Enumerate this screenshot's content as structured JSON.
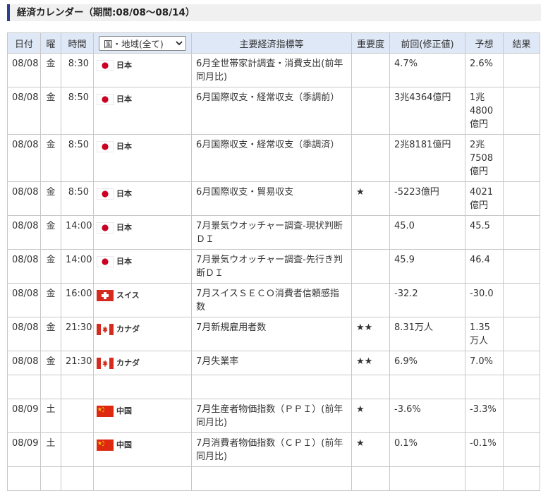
{
  "page": {
    "title": "経済カレンダー（期間:08/08〜08/14）"
  },
  "colors": {
    "accent": "#2d3f8f",
    "header_bg": "#dfe8f7"
  },
  "columns": {
    "date": "日付",
    "weekday": "曜",
    "time": "時間",
    "region_filter": "国・地域(全て)",
    "indicator": "主要経済指標等",
    "importance": "重要度",
    "previous": "前回(修正値)",
    "forecast": "予想",
    "result": "結果"
  },
  "rows": [
    {
      "date": "08/08",
      "weekday": "金",
      "time": "8:30",
      "flag": "japan-flag-icon",
      "country": "日本",
      "indicator": "6月全世帯家計調査・消費支出(前年同月比)",
      "importance": "",
      "previous": "4.7%",
      "forecast": "2.6%",
      "result": ""
    },
    {
      "date": "08/08",
      "weekday": "金",
      "time": "8:50",
      "flag": "japan-flag-icon",
      "country": "日本",
      "indicator": "6月国際収支・経常収支（季調前）",
      "importance": "",
      "previous": "3兆4364億円",
      "forecast": "1兆4800億円",
      "result": ""
    },
    {
      "date": "08/08",
      "weekday": "金",
      "time": "8:50",
      "flag": "japan-flag-icon",
      "country": "日本",
      "indicator": "6月国際収支・経常収支（季調済）",
      "importance": "",
      "previous": "2兆8181億円",
      "forecast": "2兆7508億円",
      "result": ""
    },
    {
      "date": "08/08",
      "weekday": "金",
      "time": "8:50",
      "flag": "japan-flag-icon",
      "country": "日本",
      "indicator": "6月国際収支・貿易収支",
      "importance": "★",
      "previous": "-5223億円",
      "forecast": "4021億円",
      "result": ""
    },
    {
      "date": "08/08",
      "weekday": "金",
      "time": "14:00",
      "flag": "japan-flag-icon",
      "country": "日本",
      "indicator": "7月景気ウオッチャー調査-現状判断ＤＩ",
      "importance": "",
      "previous": "45.0",
      "forecast": "45.5",
      "result": ""
    },
    {
      "date": "08/08",
      "weekday": "金",
      "time": "14:00",
      "flag": "japan-flag-icon",
      "country": "日本",
      "indicator": "7月景気ウオッチャー調査-先行き判断ＤＩ",
      "importance": "",
      "previous": "45.9",
      "forecast": "46.4",
      "result": ""
    },
    {
      "date": "08/08",
      "weekday": "金",
      "time": "16:00",
      "flag": "swiss-flag-icon",
      "country": "スイス",
      "indicator": "7月スイスＳＥＣＯ消費者信頼感指数",
      "importance": "",
      "previous": "-32.2",
      "forecast": "-30.0",
      "result": ""
    },
    {
      "date": "08/08",
      "weekday": "金",
      "time": "21:30",
      "flag": "canada-flag-icon",
      "country": "カナダ",
      "indicator": "7月新規雇用者数",
      "importance": "★★",
      "previous": "8.31万人",
      "forecast": "1.35万人",
      "result": ""
    },
    {
      "date": "08/08",
      "weekday": "金",
      "time": "21:30",
      "flag": "canada-flag-icon",
      "country": "カナダ",
      "indicator": "7月失業率",
      "importance": "★★",
      "previous": "6.9%",
      "forecast": "7.0%",
      "result": ""
    },
    {
      "blank": true
    },
    {
      "date": "08/09",
      "weekday": "土",
      "time": "",
      "flag": "china-flag-icon",
      "country": "中国",
      "indicator": "7月生産者物価指数（ＰＰＩ）(前年同月比)",
      "importance": "★",
      "previous": "-3.6%",
      "forecast": "-3.3%",
      "result": ""
    },
    {
      "date": "08/09",
      "weekday": "土",
      "time": "",
      "flag": "china-flag-icon",
      "country": "中国",
      "indicator": "7月消費者物価指数（ＣＰＩ）(前年同月比)",
      "importance": "★",
      "previous": "0.1%",
      "forecast": "-0.1%",
      "result": ""
    },
    {
      "blank": true
    }
  ]
}
